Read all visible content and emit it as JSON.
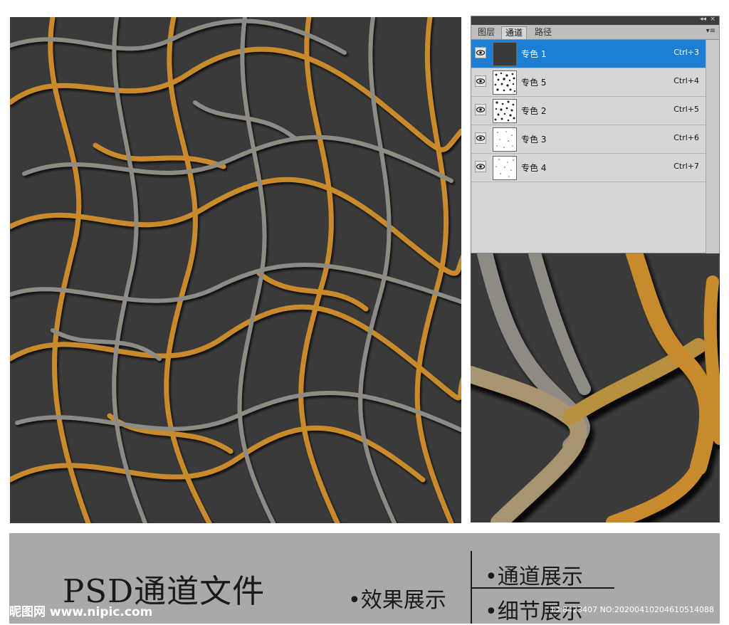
{
  "panel": {
    "collapse_icon": "◂◂",
    "close_icon": "×",
    "tabs": [
      "图层",
      "通道",
      "路径"
    ],
    "active_tab": "通道",
    "menu_icon": "▾≡",
    "channels": [
      {
        "name": "专色 1",
        "shortcut": "Ctrl+3",
        "selected": true,
        "thumb": "dark"
      },
      {
        "name": "专色 5",
        "shortcut": "Ctrl+4",
        "selected": false,
        "thumb": "noise-dense"
      },
      {
        "name": "专色 2",
        "shortcut": "Ctrl+5",
        "selected": false,
        "thumb": "noise-dense"
      },
      {
        "name": "专色 3",
        "shortcut": "Ctrl+6",
        "selected": false,
        "thumb": "noise-light"
      },
      {
        "name": "专色 4",
        "shortcut": "Ctrl+7",
        "selected": false,
        "thumb": "noise-light"
      }
    ]
  },
  "footer": {
    "title": "PSD通道文件",
    "effect": "•效果展示",
    "channel": "•通道展示",
    "detail": "•细节展示",
    "watermark_left": "昵图网 www.nipic.com",
    "watermark_right": "ID:8423407 NO:20200410204610514088"
  },
  "colors": {
    "selection": "#1c7fd6",
    "background_dark": "#3a3a3a",
    "vein_gold": "#c88a2a",
    "vein_gray": "#8e8a84",
    "footer_bg": "#a9a9a9"
  }
}
